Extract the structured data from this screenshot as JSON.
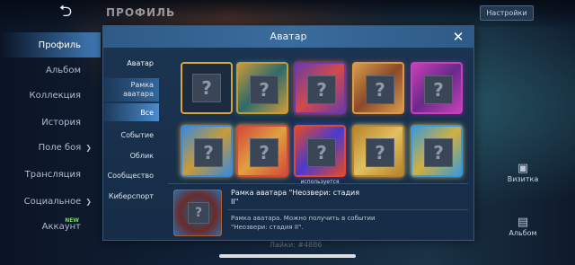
{
  "header": {
    "back_glyph": "⮌",
    "title": "ПРОФИЛЬ",
    "settings_label": "Настройки"
  },
  "sidebar": {
    "items": [
      {
        "label": "Профиль"
      },
      {
        "label": "Альбом"
      },
      {
        "label": "Коллекция"
      },
      {
        "label": "История"
      },
      {
        "label": "Поле боя"
      },
      {
        "label": "Трансляция"
      },
      {
        "label": "Социальное"
      },
      {
        "label": "Аккаунт"
      }
    ],
    "new_badge": "NEW"
  },
  "right_panel": {
    "items": [
      {
        "icon": "card-icon",
        "label": "Визитка"
      },
      {
        "icon": "photo-icon",
        "label": "Альбом"
      }
    ]
  },
  "bottom": {
    "likes_text": "Лайки: #4886"
  },
  "modal": {
    "title": "Аватар",
    "close_glyph": "✕",
    "side": {
      "avatar": "Аватар",
      "frame": "Рамка аватара",
      "all": "Все",
      "event": "Событие",
      "skin": "Облик",
      "community": "Сообщество",
      "esports": "Киберспорт"
    },
    "placeholder_glyph": "?",
    "frames": [
      {
        "in_use": "",
        "colors": [
          "#1c2b3d",
          "#1c2b3d"
        ]
      },
      {
        "in_use": "",
        "colors": [
          "#c99a3a",
          "#2d6b6a"
        ]
      },
      {
        "in_use": "",
        "colors": [
          "#6a3aa8",
          "#d24a4a"
        ]
      },
      {
        "in_use": "",
        "colors": [
          "#d89a4a",
          "#8a4a2a"
        ]
      },
      {
        "in_use": "",
        "colors": [
          "#c640b8",
          "#6a2a8a"
        ]
      },
      {
        "in_use": "",
        "colors": [
          "#3a8ad8",
          "#c99a3a"
        ]
      },
      {
        "in_use": "",
        "colors": [
          "#d24a3a",
          "#e0a040"
        ]
      },
      {
        "in_use": "используется",
        "colors": [
          "#e04a2a",
          "#4a3ad0"
        ]
      },
      {
        "in_use": "",
        "colors": [
          "#b8832a",
          "#e0c060"
        ]
      },
      {
        "in_use": "",
        "colors": [
          "#3a9ad8",
          "#d0b040"
        ]
      }
    ],
    "detail": {
      "name": "Рамка аватара \"Неозвери: стадия II\"",
      "description": "Рамка аватара. Можно получить в событии \"Неозвери: стадия II\"."
    }
  }
}
